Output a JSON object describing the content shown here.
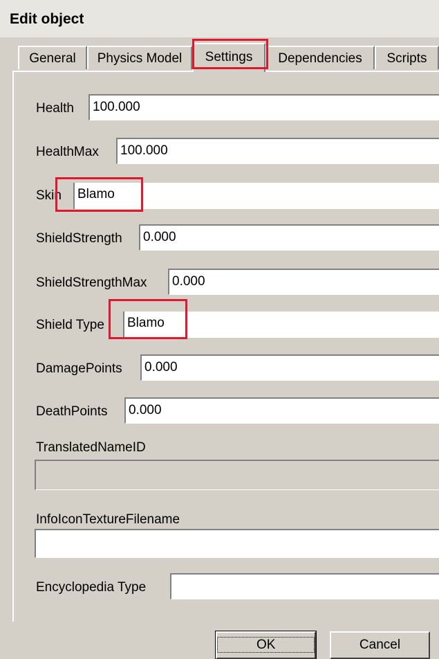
{
  "window": {
    "title": "Edit object"
  },
  "tabs": [
    {
      "label": "General"
    },
    {
      "label": "Physics Model"
    },
    {
      "label": "Settings"
    },
    {
      "label": "Dependencies"
    },
    {
      "label": "Scripts"
    }
  ],
  "fields": {
    "health": {
      "label": "Health",
      "value": "100.000"
    },
    "health_max": {
      "label": "HealthMax",
      "value": "100.000"
    },
    "skin": {
      "label": "Skin",
      "value": "Blamo"
    },
    "shield_strength": {
      "label": "ShieldStrength",
      "value": "0.000"
    },
    "shield_strength_max": {
      "label": "ShieldStrengthMax",
      "value": "0.000"
    },
    "shield_type": {
      "label": "Shield Type",
      "value": "Blamo"
    },
    "damage_points": {
      "label": "DamagePoints",
      "value": "0.000"
    },
    "death_points": {
      "label": "DeathPoints",
      "value": "0.000"
    },
    "translated_name_id": {
      "label": "TranslatedNameID",
      "value": ""
    },
    "info_icon_texture": {
      "label": "InfoIconTextureFilename",
      "value": ""
    },
    "encyclopedia_type": {
      "label": "Encyclopedia Type",
      "value": ""
    }
  },
  "buttons": {
    "ok": "OK",
    "cancel": "Cancel"
  },
  "colors": {
    "face": "#d4d0c8",
    "highlight": "#e0182d"
  }
}
